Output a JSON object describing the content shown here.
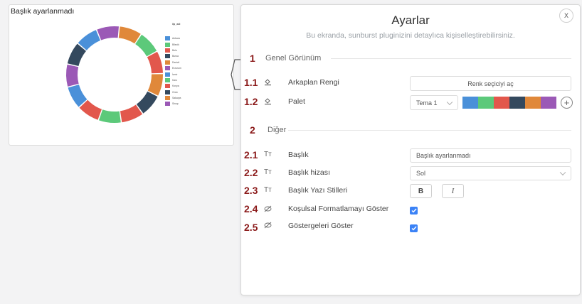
{
  "preview": {
    "title": "Başlık ayarlanmadı",
    "legend_title": "ilp_adi",
    "legend_items": [
      {
        "label": "Ankara",
        "color": "#4a90d9"
      },
      {
        "label": "Bilecik",
        "color": "#5cc97a"
      },
      {
        "label": "Bolu",
        "color": "#e2574c"
      },
      {
        "label": "Bursa",
        "color": "#34495e"
      },
      {
        "label": "Denizli",
        "color": "#e0883a"
      },
      {
        "label": "Erzurum",
        "color": "#9b59b6"
      },
      {
        "label": "İzmir",
        "color": "#4a90d9"
      },
      {
        "label": "Kars",
        "color": "#5cc97a"
      },
      {
        "label": "Konya",
        "color": "#e2574c"
      },
      {
        "label": "Ordu",
        "color": "#34495e"
      },
      {
        "label": "Sakarya",
        "color": "#e0883a"
      },
      {
        "label": "Sinop",
        "color": "#9b59b6"
      }
    ],
    "donut_colors": [
      "#e0883a",
      "#5cc97a",
      "#e2574c",
      "#e0883a",
      "#34495e",
      "#e2574c",
      "#5cc97a",
      "#e2574c",
      "#4a90d9",
      "#9b59b6",
      "#34495e",
      "#4a90d9",
      "#9b59b6"
    ]
  },
  "panel": {
    "title": "Ayarlar",
    "subtitle": "Bu ekranda, sunburst pluginizini detaylıca kişiselleştirebilirsiniz.",
    "close_label": "X",
    "sections": {
      "general": {
        "num": "1",
        "label": "Genel Görünüm"
      },
      "other": {
        "num": "2",
        "label": "Diğer"
      }
    },
    "rows": {
      "bg": {
        "num": "1.1",
        "label": "Arkaplan Rengi",
        "button": "Renk seçiciyi aç",
        "icon": "paint-bucket-icon"
      },
      "palette": {
        "num": "1.2",
        "label": "Palet",
        "value": "Tema 1",
        "colors": [
          "#4a90d9",
          "#5cc97a",
          "#e2574c",
          "#34495e",
          "#e0883a",
          "#9b59b6"
        ],
        "icon": "paint-bucket-icon"
      },
      "title": {
        "num": "2.1",
        "label": "Başlık",
        "value": "Başlık ayarlanmadı",
        "icon": "text-icon",
        "icon_glyph": "Tт"
      },
      "align": {
        "num": "2.2",
        "label": "Başlık hizası",
        "value": "Sol",
        "icon": "text-icon",
        "icon_glyph": "Tт"
      },
      "styles": {
        "num": "2.3",
        "label": "Başlık Yazı Stilleri",
        "bold": "B",
        "italic": "I",
        "icon": "text-icon",
        "icon_glyph": "Tт"
      },
      "conditional": {
        "num": "2.4",
        "label": "Koşulsal Formatlamayı Göster",
        "checked": true,
        "icon": "eye-slash-icon"
      },
      "legend": {
        "num": "2.5",
        "label": "Göstergeleri Göster",
        "checked": true,
        "icon": "eye-slash-icon"
      }
    }
  }
}
